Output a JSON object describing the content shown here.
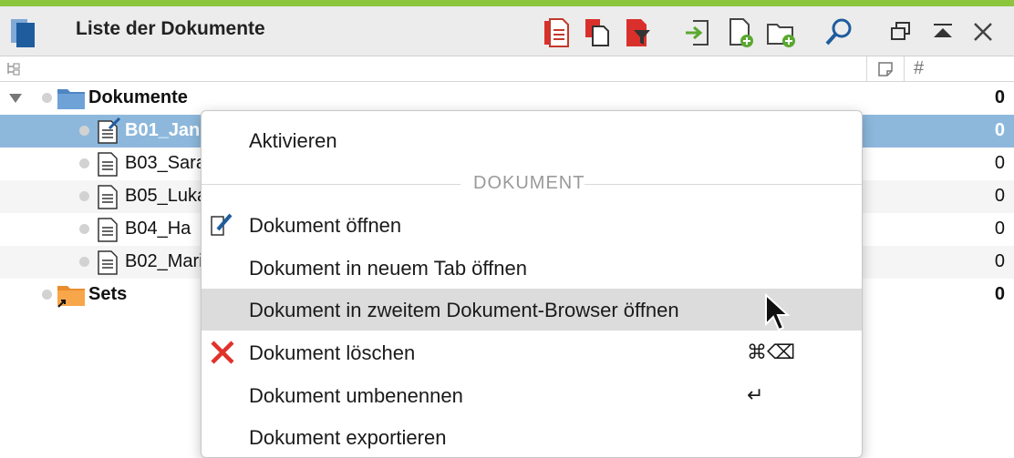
{
  "window": {
    "title": "Liste der Dokumente",
    "accent_color": "#8cc63f"
  },
  "toolbar": {
    "icons": [
      "doc-list-icon",
      "copy-docs-icon",
      "filter-icon",
      "import-icon",
      "new-doc-icon",
      "new-folder-icon",
      "search-icon",
      "float-window-icon",
      "collapse-up-icon",
      "close-icon"
    ]
  },
  "columns": {
    "tree_icon": "tree-icon",
    "memo_icon": "memo-icon",
    "count_header": "#"
  },
  "tree": {
    "root": {
      "label": "Dokumente",
      "count": "0"
    },
    "documents": [
      {
        "label": "B01_Jan",
        "count": "0",
        "selected": true
      },
      {
        "label": "B03_Sarah",
        "count": "0",
        "selected": false
      },
      {
        "label": "B05_Lukas",
        "count": "0",
        "selected": false
      },
      {
        "label": "B04_Ha",
        "count": "0",
        "selected": false
      },
      {
        "label": "B02_Maria",
        "count": "0",
        "selected": false
      }
    ],
    "sets": {
      "label": "Sets",
      "count": "0"
    }
  },
  "context_menu": {
    "activate": "Aktivieren",
    "section_title": "DOKUMENT",
    "open": "Dokument öffnen",
    "open_new_tab": "Dokument in neuem Tab öffnen",
    "open_second_browser": "Dokument in zweitem Dokument-Browser öffnen",
    "delete": "Dokument löschen",
    "delete_shortcut": "⌘⌫",
    "rename": "Dokument umbenennen",
    "rename_shortcut": "↵",
    "export": "Dokument exportieren"
  }
}
